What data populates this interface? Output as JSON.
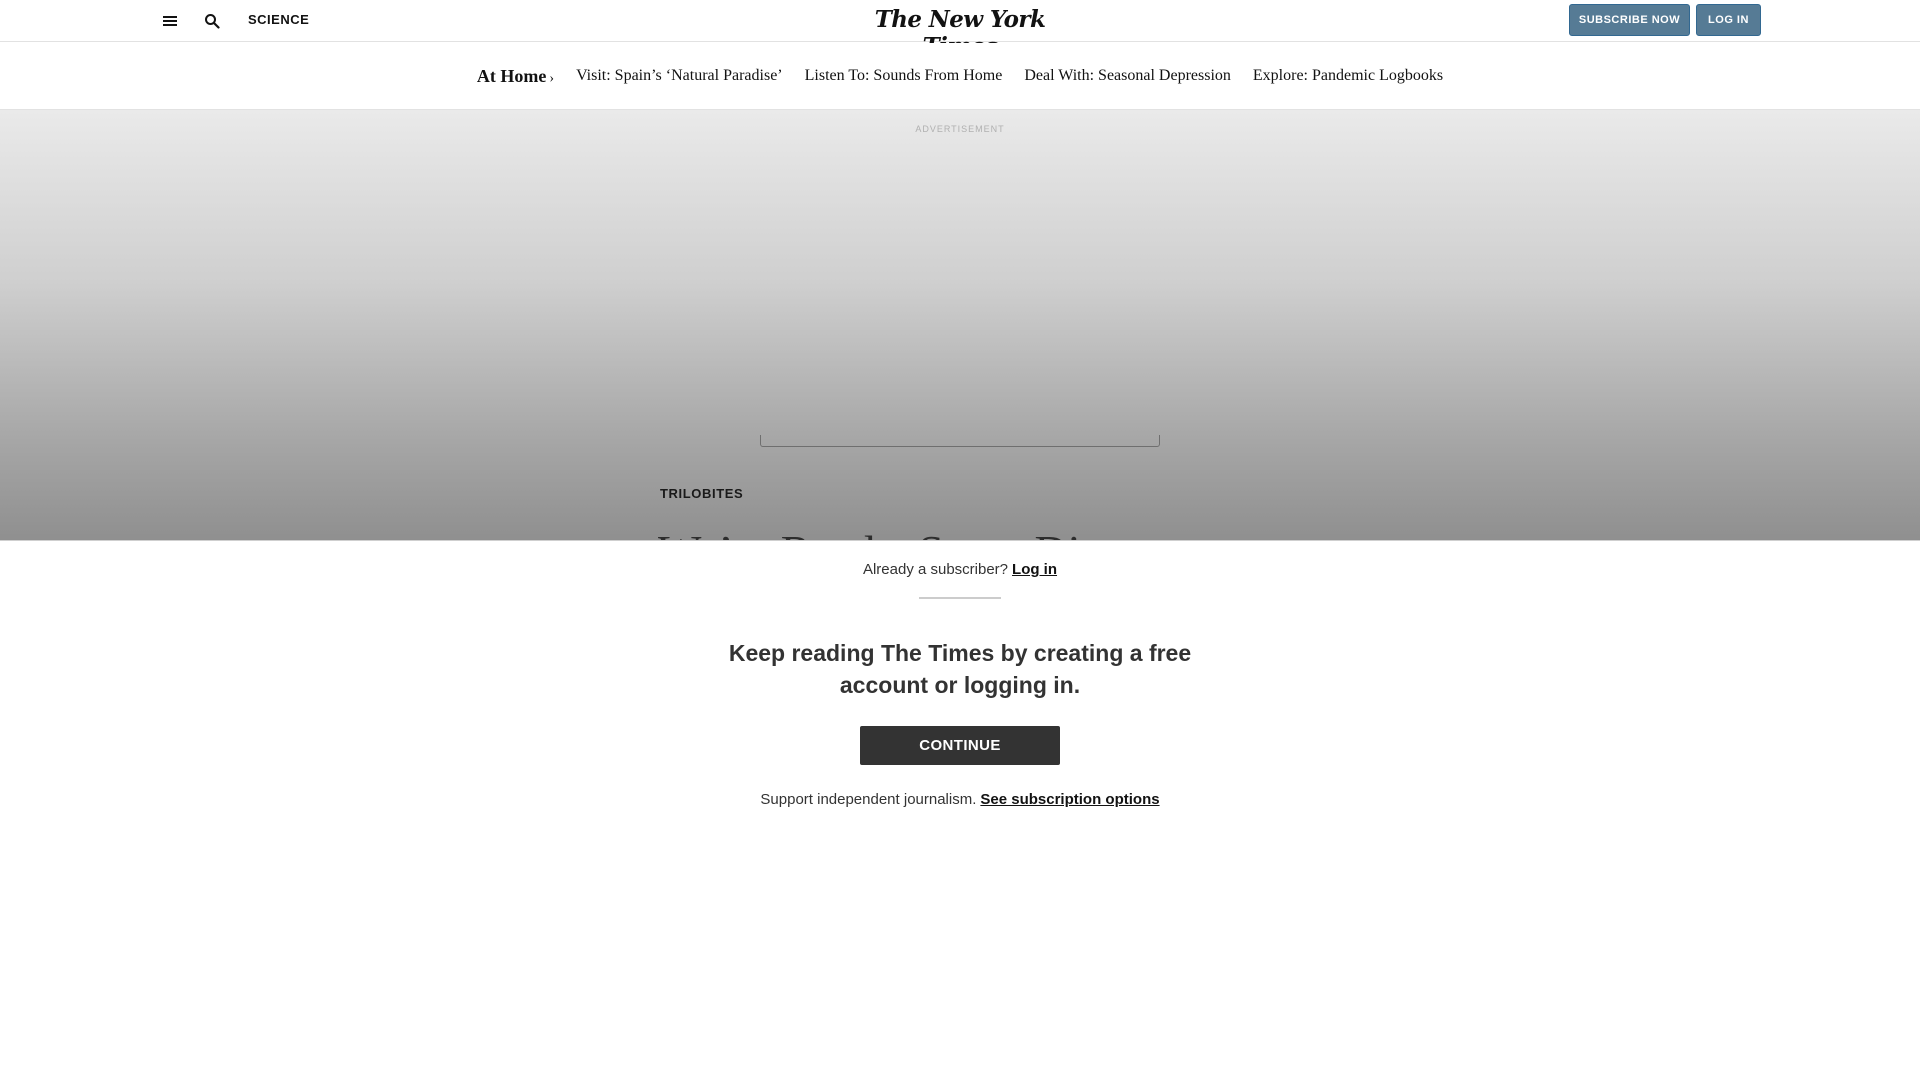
{
  "masthead": {
    "section": "SCIENCE",
    "logo": "The New York Times",
    "subscribe_label": "SUBSCRIBE NOW",
    "login_label": "LOG IN",
    "icons": [
      "menu-icon",
      "search-icon"
    ]
  },
  "subnav": {
    "title": "At Home",
    "title_chevron": "›",
    "items": [
      "Visit: Spain’s ‘Natural Paradise’",
      "Listen To: Sounds From Home",
      "Deal With: Seasonal Depression",
      "Explore: Pandemic Logbooks"
    ]
  },
  "article": {
    "ad_label": "ADVERTISEMENT",
    "kicker": "TRILOBITES",
    "headline_partial": "We’re Ready. Some Di"
  },
  "gate": {
    "already_text": "Already a subscriber?",
    "login_link": "Log in",
    "heading": "Keep reading The Times by creating a free account or logging in.",
    "continue_label": "CONTINUE",
    "support_text": "Support independent journalism.",
    "options_link": "See subscription options"
  },
  "colors": {
    "button_blue": "#567b95",
    "continue_dark": "#333333",
    "text": "#121212"
  }
}
